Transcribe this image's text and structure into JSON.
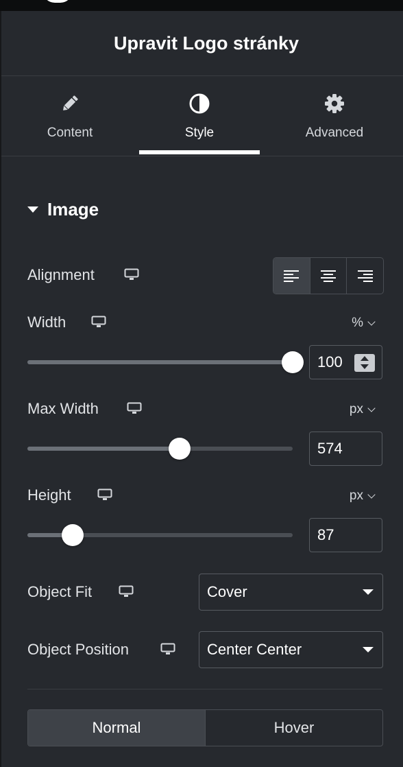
{
  "header": {
    "title": "Upravit Logo stránky"
  },
  "tabs": [
    {
      "label": "Content",
      "icon": "pencil-icon",
      "active": false
    },
    {
      "label": "Style",
      "icon": "contrast-icon",
      "active": true
    },
    {
      "label": "Advanced",
      "icon": "gear-icon",
      "active": false
    }
  ],
  "section": {
    "title": "Image"
  },
  "alignment": {
    "label": "Alignment",
    "options": [
      "left",
      "center",
      "right"
    ],
    "selected": "left"
  },
  "width": {
    "label": "Width",
    "unit": "%",
    "value": "100",
    "slider_fraction": 1.0
  },
  "max_width": {
    "label": "Max Width",
    "unit": "px",
    "value": "574",
    "slider_fraction": 0.574
  },
  "height": {
    "label": "Height",
    "unit": "px",
    "value": "87",
    "slider_fraction": 0.17
  },
  "object_fit": {
    "label": "Object Fit",
    "value": "Cover"
  },
  "object_position": {
    "label": "Object Position",
    "value": "Center Center"
  },
  "state_toggle": {
    "normal": "Normal",
    "hover": "Hover",
    "selected": "Normal"
  },
  "colors": {
    "background": "#26292e",
    "active_tab": "#ffffff",
    "control_border": "#575b61"
  }
}
